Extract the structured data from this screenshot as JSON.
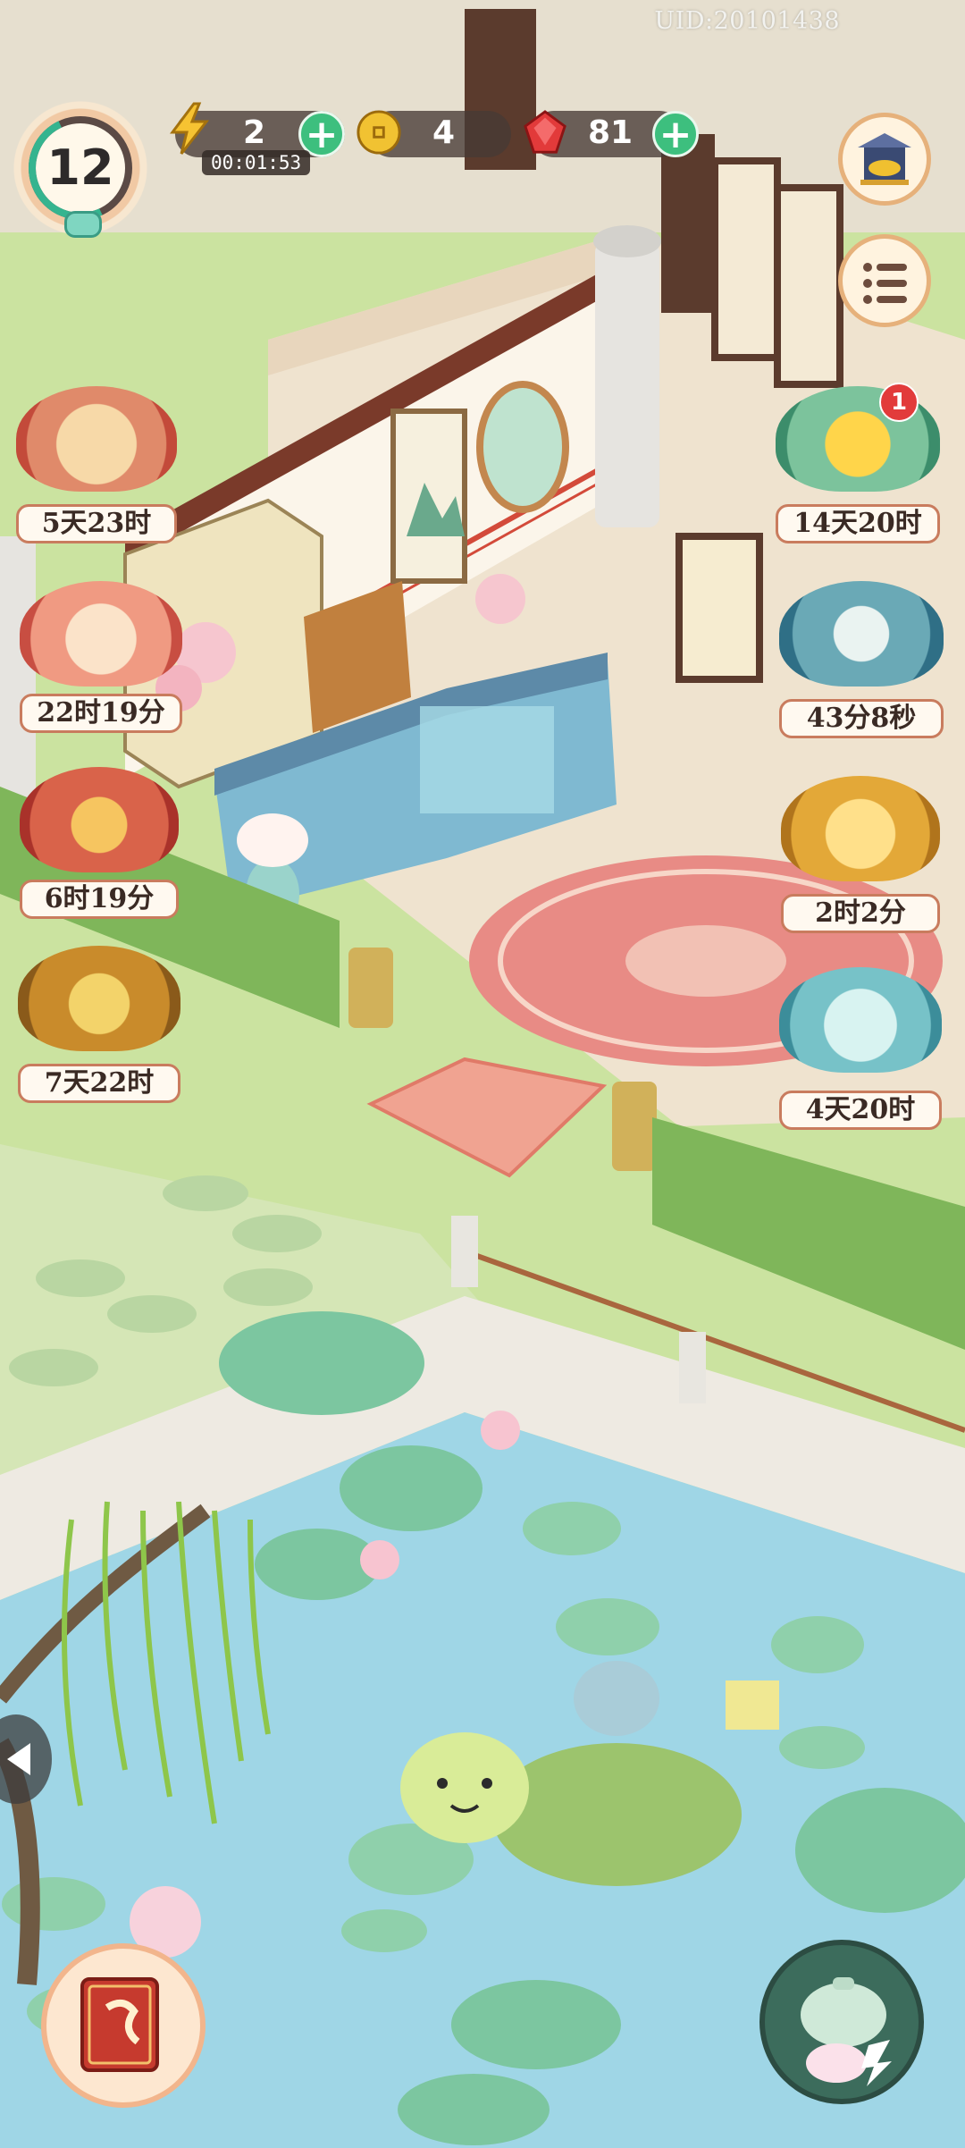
{
  "uid": "UID:20101438",
  "player": {
    "level": "12"
  },
  "resources": {
    "energy": {
      "value": "2",
      "timer": "00:01:53",
      "icon": "lightning-icon"
    },
    "coins": {
      "value": "4",
      "icon": "coin-icon"
    },
    "gems": {
      "value": "81",
      "icon": "ruby-icon"
    }
  },
  "right_buttons": [
    {
      "name": "shop-button",
      "icon": "gold-ingot-shrine-icon"
    },
    {
      "name": "menu-button",
      "icon": "list-icon"
    }
  ],
  "left_badges": [
    {
      "label": "5天23时",
      "icon": "book-scroll-icon"
    },
    {
      "label": "22时19分",
      "icon": "lion-dance-icon"
    },
    {
      "label": "6时19分",
      "icon": "calendar-chest-icon"
    },
    {
      "label": "7天22时",
      "icon": "wheat-icon"
    }
  ],
  "right_badges": [
    {
      "label": "14天20时",
      "icon": "chrysanthemum-icon",
      "notification": "1"
    },
    {
      "label": "43分8秒",
      "icon": "lucky-cat-cart-icon"
    },
    {
      "label": "2时2分",
      "icon": "golden-chest-icon"
    },
    {
      "label": "4天20时",
      "icon": "cat-gift-box-icon"
    }
  ],
  "bottom_buttons": [
    {
      "name": "journal-book-button",
      "icon": "red-book-icon"
    },
    {
      "name": "tea-pot-button",
      "icon": "teapot-bunny-icon"
    }
  ],
  "colors": {
    "plus": "#3dbf7e",
    "badge_border": "#c97c5e",
    "notify": "#e23b3b",
    "water": "#9fd6e6"
  }
}
